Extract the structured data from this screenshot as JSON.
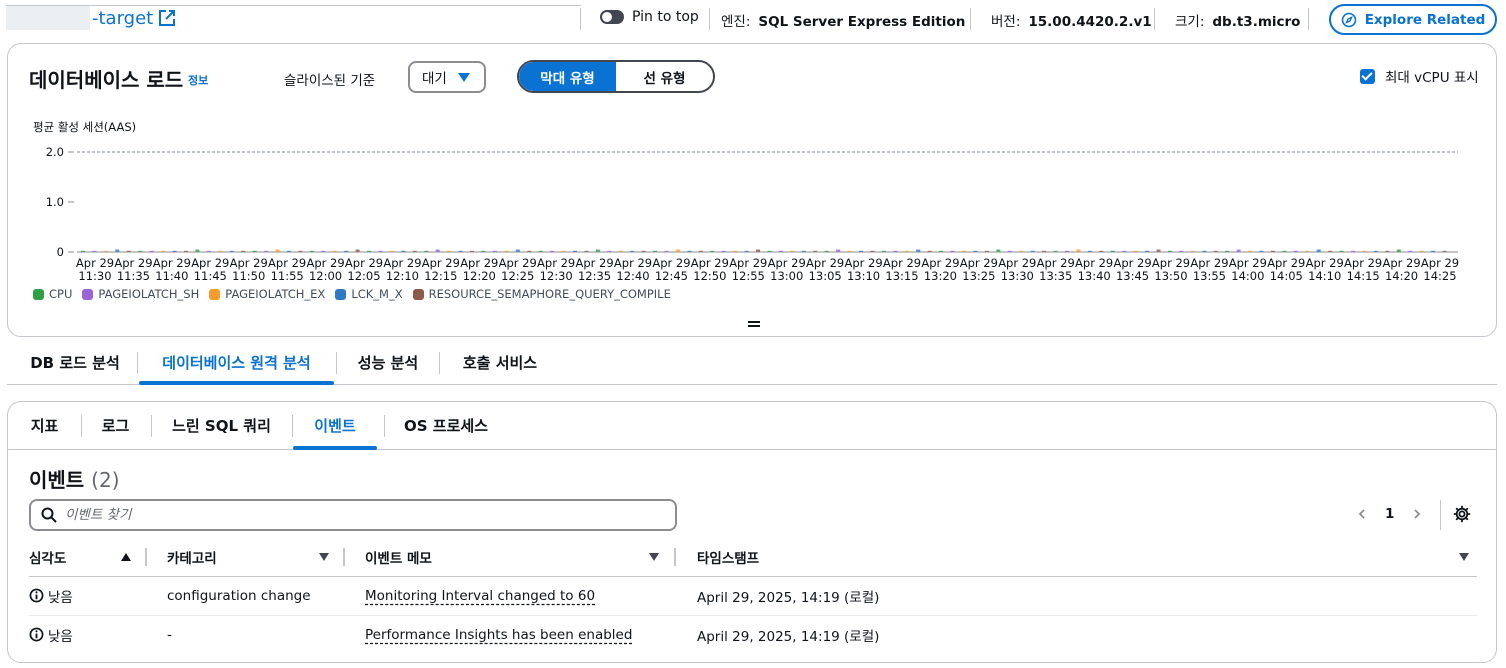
{
  "header": {
    "title_suffix": "-target",
    "pin_label": "Pin to top",
    "engine_key": "엔진:",
    "engine_value": "SQL Server Express Edition",
    "version_key": "버전:",
    "version_value": "15.00.4420.2.v1",
    "size_key": "크기:",
    "size_value": "db.t3.micro",
    "explore_label": "Explore Related"
  },
  "load": {
    "title": "데이터베이스 로드",
    "info": "정보",
    "slice_label": "슬라이스된 기준",
    "slice_value": "대기",
    "view_bar": "막대 유형",
    "view_line": "선 유형",
    "vcpu_label": "최대 vCPU 표시",
    "y_axis_label": "평균 활성 세션(AAS)"
  },
  "chart_data": {
    "type": "bar",
    "ylabel": "평균 활성 세션(AAS)",
    "ylim": [
      0,
      2.0
    ],
    "yticks": [
      "2.0",
      "1.0",
      "0"
    ],
    "max_vcpu_line": 2.0,
    "x_date_label": "Apr 29",
    "categories": [
      "11:30",
      "11:35",
      "11:40",
      "11:45",
      "11:50",
      "11:55",
      "12:00",
      "12:05",
      "12:10",
      "12:15",
      "12:20",
      "12:25",
      "12:30",
      "12:35",
      "12:40",
      "12:45",
      "12:50",
      "12:55",
      "13:00",
      "13:05",
      "13:10",
      "13:15",
      "13:20",
      "13:25",
      "13:30",
      "13:35",
      "13:40",
      "13:45",
      "13:50",
      "13:55",
      "14:00",
      "14:05",
      "14:10",
      "14:15",
      "14:20",
      "14:25"
    ],
    "legend": [
      {
        "name": "CPU",
        "color": "#2ea043"
      },
      {
        "name": "PAGEIOLATCH_SH",
        "color": "#9a63d6"
      },
      {
        "name": "PAGEIOLATCH_EX",
        "color": "#f89b2c"
      },
      {
        "name": "LCK_M_X",
        "color": "#2f78c4"
      },
      {
        "name": "RESOURCE_SEMAPHORE_QUERY_COMPILE",
        "color": "#8d5a4a"
      }
    ],
    "grid": false,
    "legend_position": "bottom-left"
  },
  "tabs": [
    {
      "label": "DB 로드 분석"
    },
    {
      "label": "데이터베이스 원격 분석"
    },
    {
      "label": "성능 분석"
    },
    {
      "label": "호출 서비스"
    }
  ],
  "subtabs": [
    {
      "label": "지표"
    },
    {
      "label": "로그"
    },
    {
      "label": "느린 SQL 쿼리"
    },
    {
      "label": "이벤트"
    },
    {
      "label": "OS 프로세스"
    }
  ],
  "events": {
    "title": "이벤트",
    "count": "(2)",
    "search_placeholder": "이벤트 찾기",
    "page": "1",
    "columns": [
      "심각도",
      "카테고리",
      "이벤트 메모",
      "타임스탬프"
    ],
    "rows": [
      {
        "severity": "낮음",
        "category": "configuration change",
        "memo": "Monitoring Interval changed to 60",
        "timestamp": "April 29, 2025, 14:19 (로컬)"
      },
      {
        "severity": "낮음",
        "category": "-",
        "memo": "Performance Insights has been enabled",
        "timestamp": "April 29, 2025, 14:19 (로컬)"
      }
    ]
  }
}
